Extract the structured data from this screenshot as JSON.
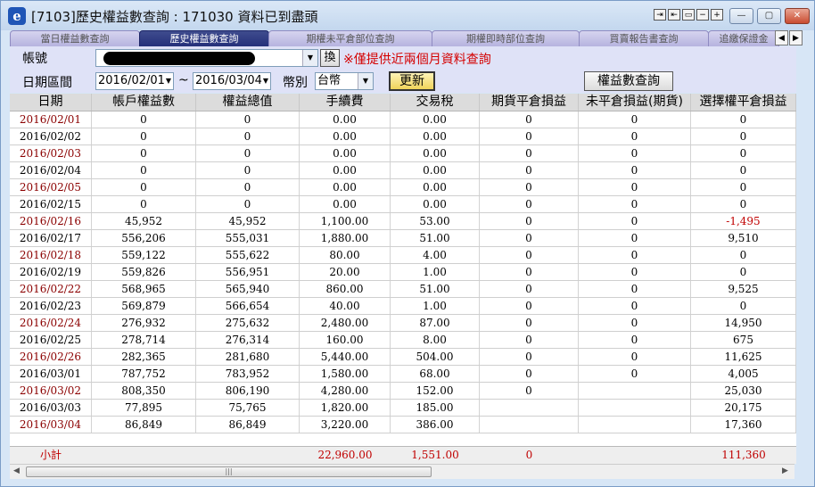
{
  "window": {
    "title": "[7103]歷史權益數查詢 : 171030 資料已到盡頭",
    "app_icon": "e-icon"
  },
  "tabs": [
    {
      "label": "當日權益數查詢"
    },
    {
      "label": "歷史權益數查詢",
      "active": true
    },
    {
      "label": "期權未平倉部位查詢"
    },
    {
      "label": "期權即時部位查詢"
    },
    {
      "label": "買賣報告書查詢"
    },
    {
      "label": "追繳保證金"
    }
  ],
  "form": {
    "account_label": "帳號",
    "switch_label": "換",
    "warning": "※僅提供近兩個月資料查詢",
    "range_label": "日期區間",
    "start_date": "2016/02/01",
    "tilde": "~",
    "end_date": "2016/03/04",
    "currency_label": "幣別",
    "currency_value": "台幣",
    "refresh_label": "更新",
    "query_label": "權益數查詢"
  },
  "table": {
    "columns": [
      "日期",
      "帳戶權益數",
      "權益總值",
      "手續費",
      "交易稅",
      "期貨平倉損益",
      "未平倉損益(期貨)",
      "選擇權平倉損益"
    ],
    "rows": [
      [
        "2016/02/01",
        "0",
        "0",
        "0.00",
        "0.00",
        "0",
        "0",
        "0"
      ],
      [
        "2016/02/02",
        "0",
        "0",
        "0.00",
        "0.00",
        "0",
        "0",
        "0"
      ],
      [
        "2016/02/03",
        "0",
        "0",
        "0.00",
        "0.00",
        "0",
        "0",
        "0"
      ],
      [
        "2016/02/04",
        "0",
        "0",
        "0.00",
        "0.00",
        "0",
        "0",
        "0"
      ],
      [
        "2016/02/05",
        "0",
        "0",
        "0.00",
        "0.00",
        "0",
        "0",
        "0"
      ],
      [
        "2016/02/15",
        "0",
        "0",
        "0.00",
        "0.00",
        "0",
        "0",
        "0"
      ],
      [
        "2016/02/16",
        "45,952",
        "45,952",
        "1,100.00",
        "53.00",
        "0",
        "0",
        "-1,495"
      ],
      [
        "2016/02/17",
        "556,206",
        "555,031",
        "1,880.00",
        "51.00",
        "0",
        "0",
        "9,510"
      ],
      [
        "2016/02/18",
        "559,122",
        "555,622",
        "80.00",
        "4.00",
        "0",
        "0",
        "0"
      ],
      [
        "2016/02/19",
        "559,826",
        "556,951",
        "20.00",
        "1.00",
        "0",
        "0",
        "0"
      ],
      [
        "2016/02/22",
        "568,965",
        "565,940",
        "860.00",
        "51.00",
        "0",
        "0",
        "9,525"
      ],
      [
        "2016/02/23",
        "569,879",
        "566,654",
        "40.00",
        "1.00",
        "0",
        "0",
        "0"
      ],
      [
        "2016/02/24",
        "276,932",
        "275,632",
        "2,480.00",
        "87.00",
        "0",
        "0",
        "14,950"
      ],
      [
        "2016/02/25",
        "278,714",
        "276,314",
        "160.00",
        "8.00",
        "0",
        "0",
        "675"
      ],
      [
        "2016/02/26",
        "282,365",
        "281,680",
        "5,440.00",
        "504.00",
        "0",
        "0",
        "11,625"
      ],
      [
        "2016/03/01",
        "787,752",
        "783,952",
        "1,580.00",
        "68.00",
        "0",
        "0",
        "4,005"
      ],
      [
        "2016/03/02",
        "808,350",
        "806,190",
        "4,280.00",
        "152.00",
        "0",
        "",
        "25,030"
      ],
      [
        "2016/03/03",
        "77,895",
        "75,765",
        "1,820.00",
        "185.00",
        "",
        "",
        "20,175"
      ],
      [
        "2016/03/04",
        "86,849",
        "86,849",
        "3,220.00",
        "386.00",
        "",
        "",
        "17,360"
      ]
    ],
    "date_red": [
      true,
      false,
      true,
      false,
      true,
      false,
      true,
      false,
      true,
      false,
      true,
      false,
      true,
      false,
      true,
      false,
      true,
      false,
      true
    ],
    "total": {
      "label": "小計",
      "fee": "22,960.00",
      "tax": "1,551.00",
      "futures_pl": "0",
      "options_pl": "111,360"
    }
  },
  "colors": {
    "red_text": "#c00000",
    "dark_red_date": "#8b0000",
    "active_tab": "#25307a",
    "refresh_button": "#f0d35a"
  }
}
